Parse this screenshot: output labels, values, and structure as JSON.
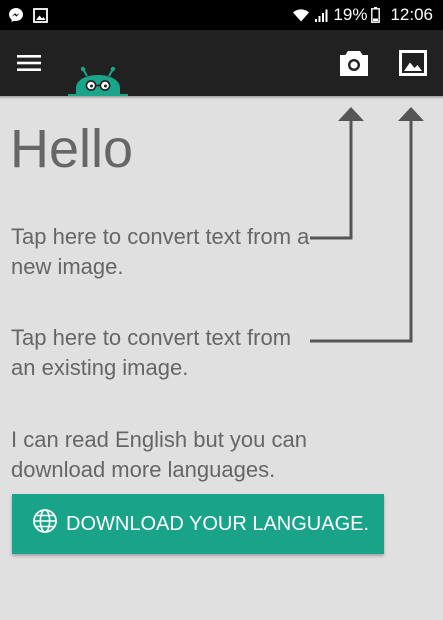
{
  "status_bar": {
    "battery": "19%",
    "time": "12:06",
    "icons": [
      "messenger-icon",
      "gallery-notification-icon",
      "wifi-icon",
      "signal-icon",
      "battery-icon"
    ]
  },
  "toolbar": {
    "menu_icon": "hamburger-menu-icon",
    "camera_icon": "camera-icon",
    "image_icon": "image-icon",
    "background": "#212121"
  },
  "content": {
    "greeting": "Hello",
    "camera_hint": "Tap here to convert text from a new image.",
    "gallery_hint": "Tap here to convert text from an existing image.",
    "language_hint": "I can read English but you can download more languages."
  },
  "download_button": {
    "label": "DOWNLOAD YOUR LANGUAGE.",
    "icon": "globe-icon",
    "color": "#19a48a"
  },
  "colors": {
    "background": "#e0e0e0",
    "text": "#666666",
    "accent": "#19a48a",
    "arrow": "#555555"
  }
}
